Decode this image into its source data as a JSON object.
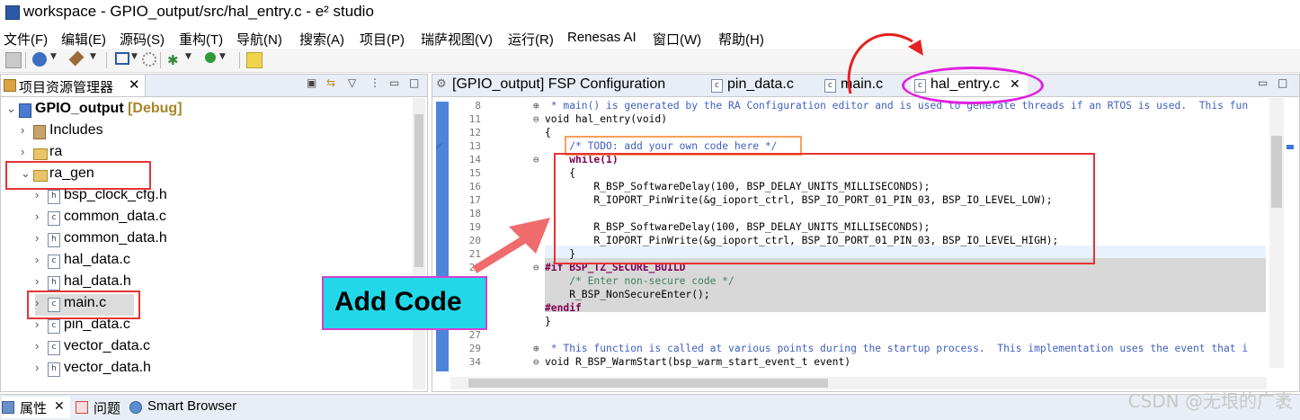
{
  "window": {
    "title": "workspace - GPIO_output/src/hal_entry.c - e² studio"
  },
  "menu": [
    "文件(F)",
    "编辑(E)",
    "源码(S)",
    "重构(T)",
    "导航(N)",
    "搜索(A)",
    "项目(P)",
    "瑞萨视图(V)",
    "运行(R)",
    "Renesas AI",
    "窗口(W)",
    "帮助(H)"
  ],
  "left_panel": {
    "tab_label": "项目资源管理器",
    "tree": [
      {
        "label": "GPIO_output",
        "suffix": " [Debug]",
        "icon": "project-icon",
        "expanded": true
      },
      {
        "label": "Includes",
        "icon": "includes-icon"
      },
      {
        "label": "ra",
        "icon": "folder-icon"
      },
      {
        "label": "ra_gen",
        "icon": "folder-icon",
        "expanded": true
      },
      {
        "label": "bsp_clock_cfg.h",
        "icon": "h-file-icon"
      },
      {
        "label": "common_data.c",
        "icon": "c-file-icon"
      },
      {
        "label": "common_data.h",
        "icon": "h-file-icon"
      },
      {
        "label": "hal_data.c",
        "icon": "c-file-icon"
      },
      {
        "label": "hal_data.h",
        "icon": "h-file-icon"
      },
      {
        "label": "main.c",
        "icon": "c-file-icon"
      },
      {
        "label": "pin_data.c",
        "icon": "c-file-icon"
      },
      {
        "label": "vector_data.c",
        "icon": "c-file-icon"
      },
      {
        "label": "vector_data.h",
        "icon": "h-file-icon"
      }
    ]
  },
  "editor_tabs": [
    {
      "label": "[GPIO_output] FSP Configuration",
      "icon": "gear-icon"
    },
    {
      "label": "pin_data.c",
      "icon": "c-file-icon"
    },
    {
      "label": "main.c",
      "icon": "c-file-icon"
    },
    {
      "label": "hal_entry.c",
      "icon": "c-file-icon",
      "active": true,
      "close": "✕"
    }
  ],
  "code": {
    "line_numbers": [
      "8",
      "11",
      "12",
      "13",
      "14",
      "15",
      "16",
      "17",
      "18",
      "19",
      "20",
      "21",
      "22",
      "",
      "",
      "",
      "",
      "27",
      "29",
      "34"
    ],
    "lines": [
      " * main() is generated by the RA Configuration editor and is used to generate threads if an RTOS is used.  This fun",
      "void hal_entry(void)",
      "{",
      "    /* TODO: add your own code here */",
      "    while(1)",
      "    {",
      "        R_BSP_SoftwareDelay(100, BSP_DELAY_UNITS_MILLISECONDS);",
      "        R_IOPORT_PinWrite(&g_ioport_ctrl, BSP_IO_PORT_01_PIN_03, BSP_IO_LEVEL_LOW);",
      "",
      "        R_BSP_SoftwareDelay(100, BSP_DELAY_UNITS_MILLISECONDS);",
      "        R_IOPORT_PinWrite(&g_ioport_ctrl, BSP_IO_PORT_01_PIN_03, BSP_IO_LEVEL_HIGH);",
      "    }",
      "#if BSP_TZ_SECURE_BUILD",
      "    /* Enter non-secure code */",
      "    R_BSP_NonSecureEnter();",
      "#endif",
      "}",
      "",
      " * This function is called at various points during the startup process.  This implementation uses the event that i",
      "void R_BSP_WarmStart(bsp_warm_start_event_t event)"
    ]
  },
  "annotation": {
    "label": "Add Code"
  },
  "bottom_tabs": [
    {
      "label": "属性",
      "icon": "properties-icon",
      "close": "✕"
    },
    {
      "label": "问题",
      "icon": "problems-icon"
    },
    {
      "label": "Smart Browser",
      "icon": "globe-icon"
    }
  ],
  "watermark": "CSDN @无垠的广袤"
}
